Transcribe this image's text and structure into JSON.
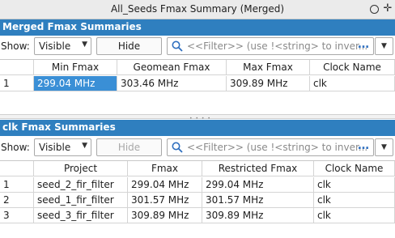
{
  "window": {
    "title": "All_Seeds Fmax Summary (Merged)"
  },
  "merged": {
    "header": "Merged Fmax Summaries",
    "show_label": "Show:",
    "show_value": "Visible",
    "hide_label": "Hide",
    "filter_placeholder": "<<Filter>> (use !<string> to inver...",
    "columns": [
      "",
      "Min Fmax",
      "Geomean Fmax",
      "Max Fmax",
      "Clock Name"
    ],
    "rows": [
      [
        "1",
        "299.04 MHz",
        "303.46 MHz",
        "309.89 MHz",
        "clk"
      ]
    ]
  },
  "clk": {
    "header": "clk Fmax Summaries",
    "show_label": "Show:",
    "show_value": "Visible",
    "hide_label": "Hide",
    "filter_placeholder": "<<Filter>> (use !<string> to inver...",
    "columns": [
      "",
      "Project",
      "Fmax",
      "Restricted Fmax",
      "Clock Name"
    ],
    "rows": [
      [
        "1",
        "seed_2_fir_filter",
        "299.04 MHz",
        "299.04 MHz",
        "clk"
      ],
      [
        "2",
        "seed_1_fir_filter",
        "301.57 MHz",
        "301.57 MHz",
        "clk"
      ],
      [
        "3",
        "seed_3_fir_filter",
        "309.89 MHz",
        "309.89 MHz",
        "clk"
      ]
    ]
  },
  "colors": {
    "header_bg": "#2f7fbf",
    "selection_bg": "#3a8fd6"
  },
  "icons": {
    "restore": "circle-restore-icon",
    "move": "move-cross-icon",
    "search": "search-icon",
    "dropdown": "chevron-down-icon",
    "more": "ellipsis-icon"
  }
}
